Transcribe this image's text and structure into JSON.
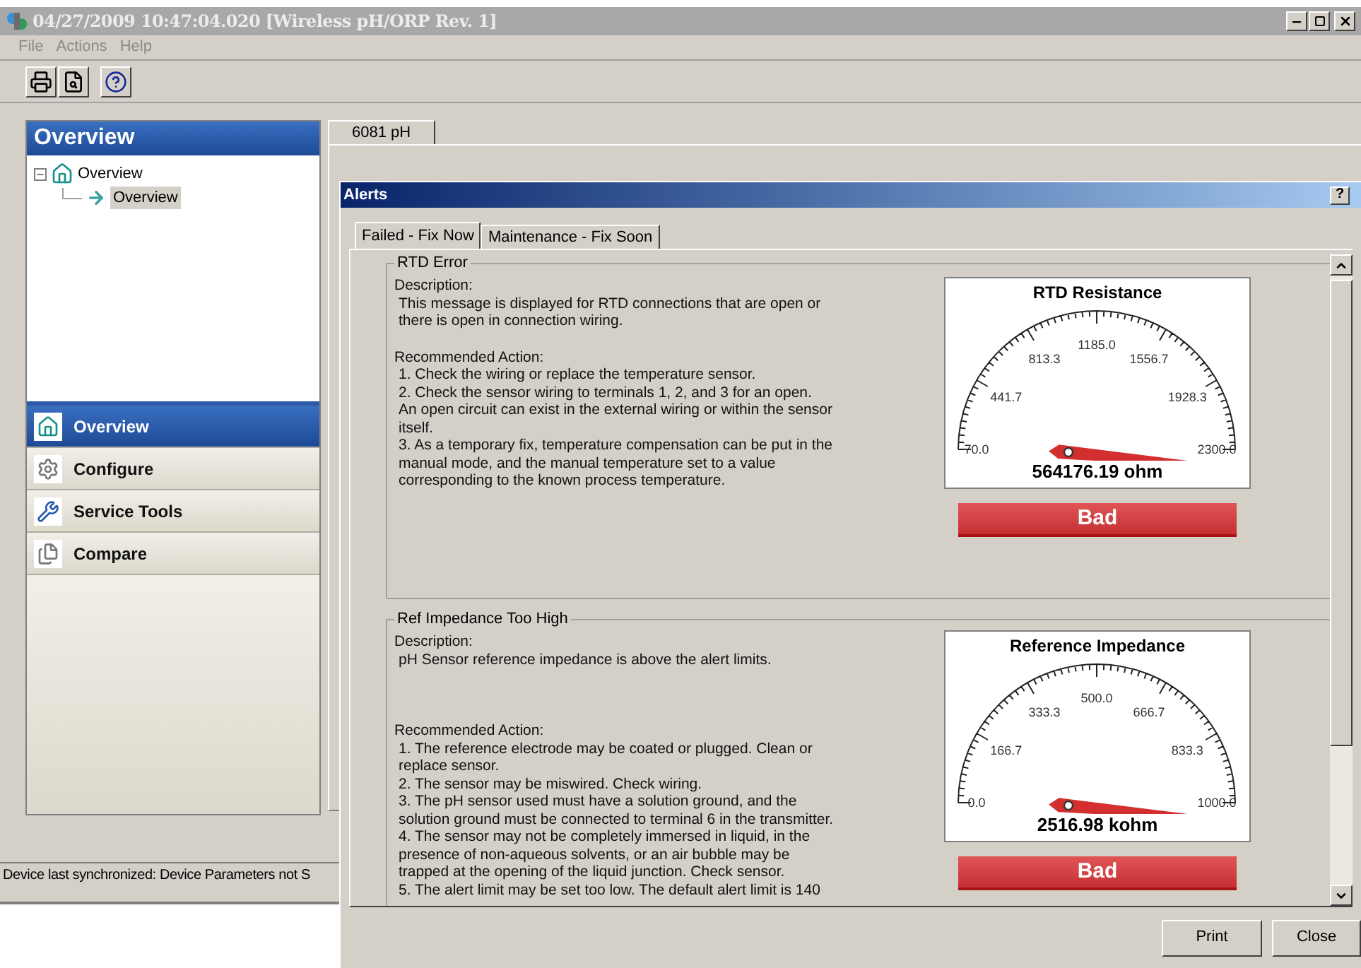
{
  "window": {
    "title": "04/27/2009 10:47:04.020 [Wireless pH/ORP Rev. 1]"
  },
  "menu": [
    "File",
    "Actions",
    "Help"
  ],
  "navigator": {
    "title": "Overview",
    "tree": [
      {
        "label": "Overview",
        "expanded": true,
        "children": [
          {
            "label": "Overview",
            "selected": true
          }
        ]
      }
    ],
    "sections": [
      {
        "label": "Overview",
        "selected": true
      },
      {
        "label": "Configure",
        "selected": false
      },
      {
        "label": "Service Tools",
        "selected": false
      },
      {
        "label": "Compare",
        "selected": false
      }
    ]
  },
  "device_tabs": [
    {
      "label": "6081 pH",
      "selected": true
    }
  ],
  "status_bar": "Device last synchronized: Device Parameters not S",
  "alerts_dialog": {
    "title": "Alerts",
    "help_button": "?",
    "tabs": [
      {
        "label": "Failed - Fix Now",
        "selected": true
      },
      {
        "label": "Maintenance - Fix Soon",
        "selected": false
      }
    ],
    "alerts": [
      {
        "title": "RTD Error",
        "description_label": "Description:",
        "description": "This message is displayed for RTD connections that are open or there is open in connection wiring.",
        "action_label": "Recommended Action:",
        "actions": [
          "1. Check the wiring or replace the temperature sensor.",
          "2. Check the sensor wiring to terminals 1, 2, and 3 for an open.",
          "An open circuit can exist in the external wiring or within the sensor itself.",
          "3. As a temporary fix, temperature compensation can be put in the manual mode, and the manual temperature set to a value corresponding to the known process temperature."
        ],
        "gauge": {
          "title": "RTD Resistance",
          "scale": [
            "70.0",
            "441.7",
            "813.3",
            "1185.0",
            "1556.7",
            "1928.3",
            "2300.0"
          ],
          "reading": "564176.19 ohm",
          "status": "Bad"
        }
      },
      {
        "title": "Ref Impedance Too High",
        "description_label": "Description:",
        "description": "pH Sensor reference impedance is above the alert limits.",
        "action_label": "Recommended Action:",
        "actions": [
          "1. The reference electrode may be coated or plugged. Clean or replace sensor.",
          "2. The sensor may be miswired. Check wiring.",
          "3. The pH sensor used must have a solution ground, and the solution ground must be connected to terminal 6 in the transmitter.",
          "4. The sensor may not be completely immersed in liquid, in the presence of non-aqueous solvents, or an air bubble may be trapped at the opening of the liquid junction. Check sensor.",
          "5. The alert limit may be set too low. The default alert limit is 140"
        ],
        "gauge": {
          "title": "Reference Impedance",
          "scale": [
            "0.0",
            "166.7",
            "333.3",
            "500.0",
            "666.7",
            "833.3",
            "1000.0"
          ],
          "reading": "2516.98 kohm",
          "status": "Bad"
        }
      }
    ],
    "buttons": [
      "Print",
      "Close"
    ]
  }
}
